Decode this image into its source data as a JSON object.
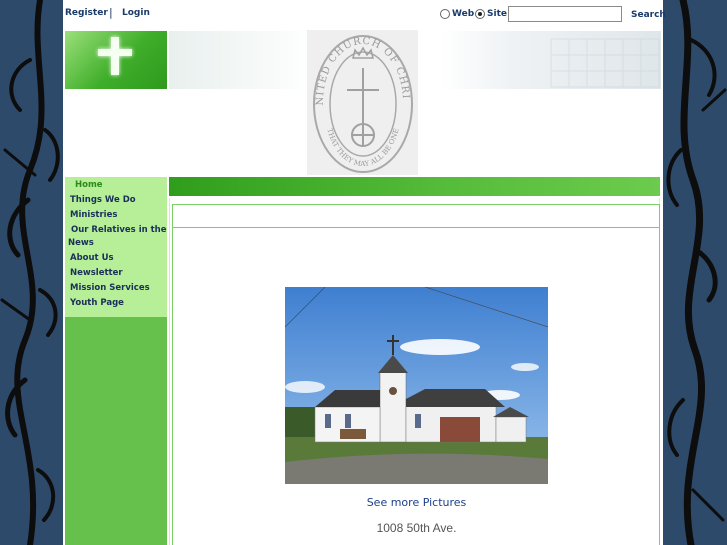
{
  "topbar": {
    "register": "Register",
    "separator": "|",
    "login": "Login",
    "radio_web": "Web",
    "radio_site": "Site",
    "selected": "Site",
    "search_button": "Search",
    "search_value": ""
  },
  "header": {
    "logo_text_top": "UNITED CHURCH OF CHRIST",
    "logo_text_bottom": "THAT THEY MAY ALL BE ONE"
  },
  "sidebar": {
    "items": [
      {
        "label": "Home",
        "active": true
      },
      {
        "label": "Things We Do"
      },
      {
        "label": "Ministries"
      },
      {
        "label": "Our Relatives in the News"
      },
      {
        "label": "About Us"
      },
      {
        "label": "Newsletter"
      },
      {
        "label": "Mission Services"
      },
      {
        "label": "Youth Page"
      }
    ]
  },
  "main": {
    "more_pictures": "See more Pictures",
    "address": "1008 50th Ave."
  },
  "colors": {
    "accent_green": "#55bb3a",
    "nav_bg": "#b6ef98",
    "link_blue": "#1c3f8a",
    "page_bg": "#2e4a6b"
  }
}
